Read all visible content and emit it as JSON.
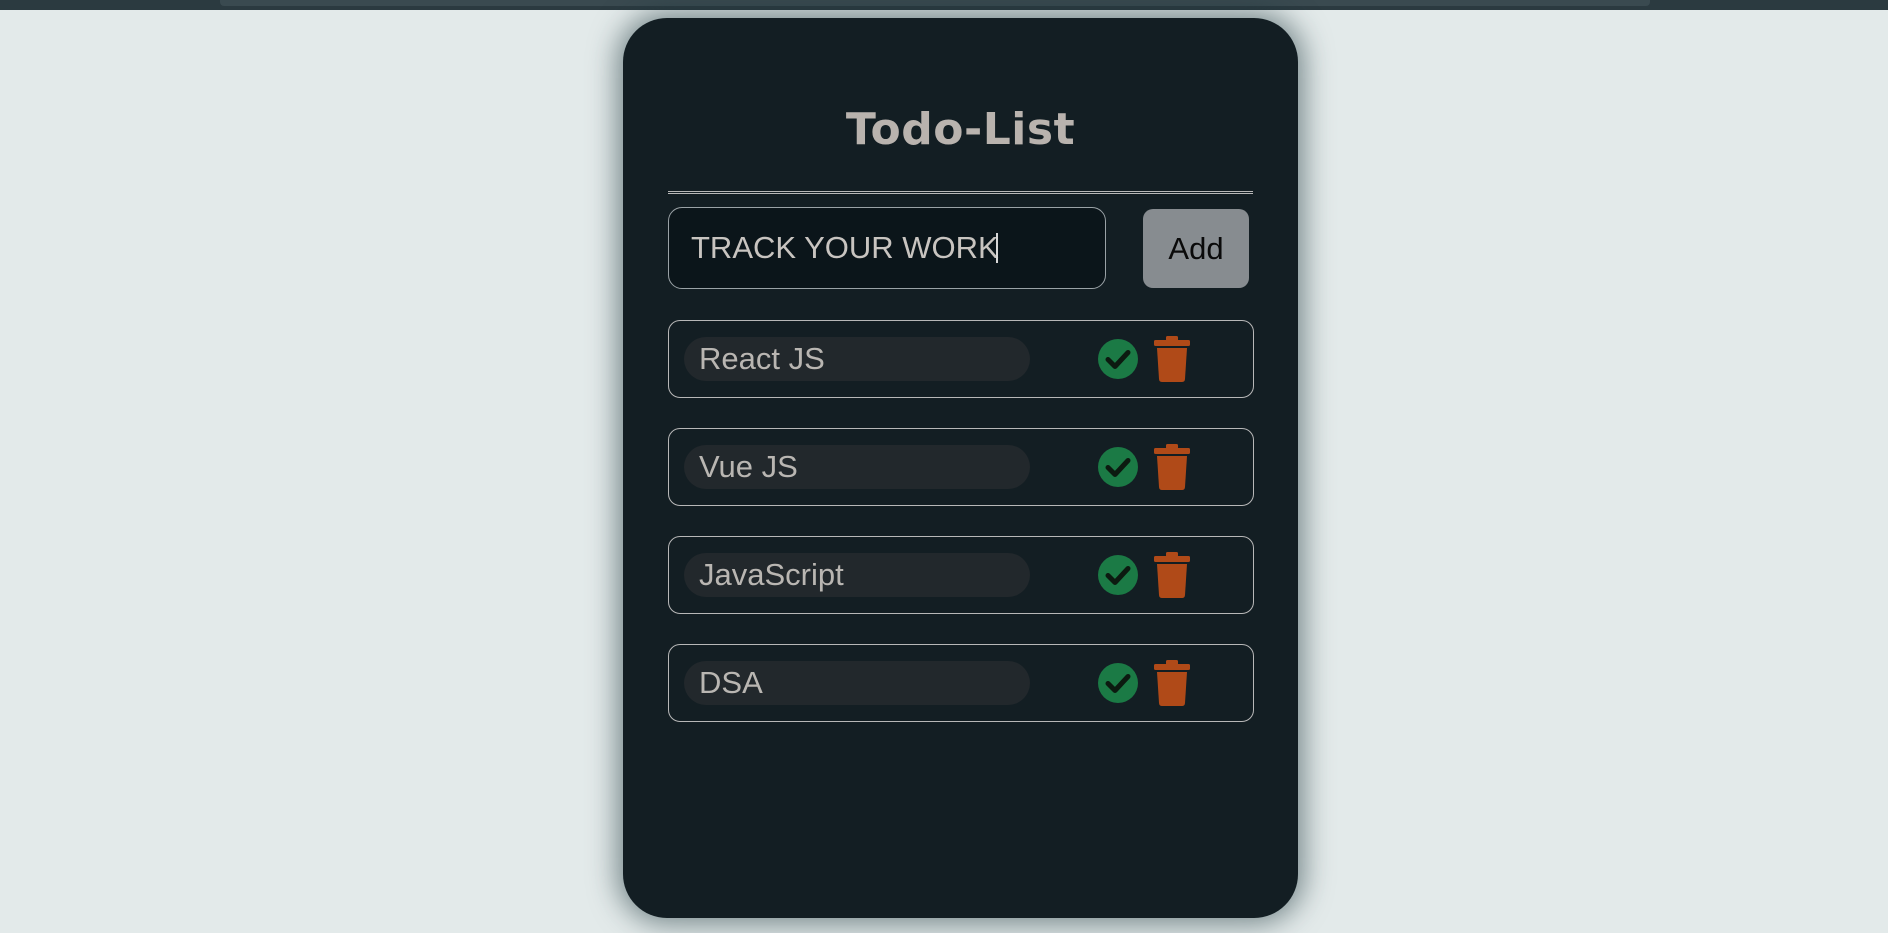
{
  "header": {
    "title": "Todo-List"
  },
  "input": {
    "value": "TRACK YOUR WORK",
    "placeholder": ""
  },
  "add_button": {
    "label": "Add"
  },
  "todos": [
    {
      "text": "React JS"
    },
    {
      "text": "Vue JS"
    },
    {
      "text": "JavaScript"
    },
    {
      "text": "DSA"
    }
  ],
  "icons": {
    "complete": "check-circle-icon",
    "delete": "trash-icon"
  },
  "colors": {
    "page_background": "#e3eaea",
    "card_background": "#131e23",
    "title": "#b9b3ae",
    "check": "#1b7a45",
    "trash": "#b04a18",
    "add_button": "#878c90"
  }
}
